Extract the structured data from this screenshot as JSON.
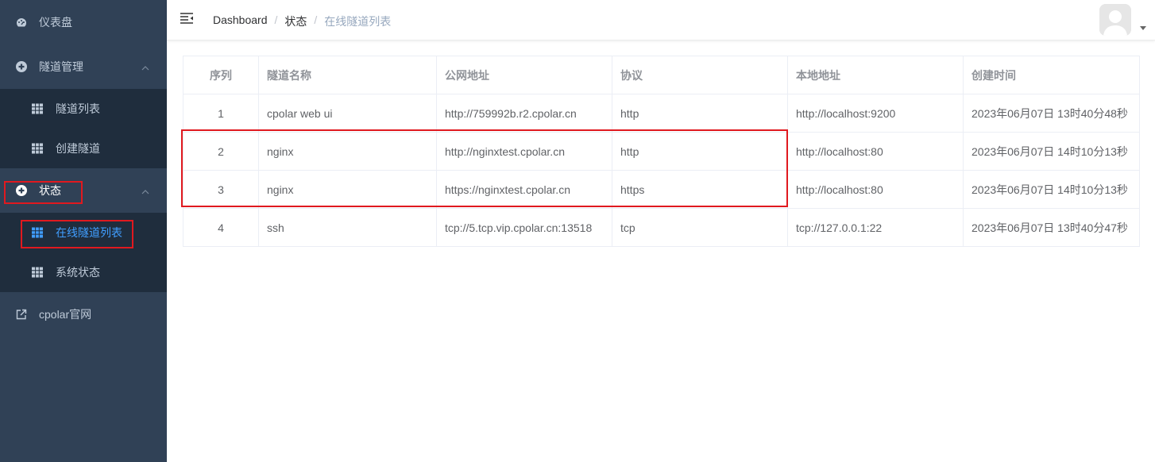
{
  "sidebar": {
    "dashboard": "仪表盘",
    "tunnel_mgmt": "隧道管理",
    "tunnel_list": "隧道列表",
    "create_tunnel": "创建隧道",
    "status": "状态",
    "online_tunnels": "在线隧道列表",
    "system_status": "系统状态",
    "cpolar_site": "cpolar官网"
  },
  "breadcrumb": {
    "items": [
      "Dashboard",
      "状态",
      "在线隧道列表"
    ],
    "separator": "/"
  },
  "table": {
    "headers": [
      "序列",
      "隧道名称",
      "公网地址",
      "协议",
      "本地地址",
      "创建时间"
    ],
    "rows": [
      [
        "1",
        "cpolar web ui",
        "http://759992b.r2.cpolar.cn",
        "http",
        "http://localhost:9200",
        "2023年06月07日 13时40分48秒"
      ],
      [
        "2",
        "nginx",
        "http://nginxtest.cpolar.cn",
        "http",
        "http://localhost:80",
        "2023年06月07日 14时10分13秒"
      ],
      [
        "3",
        "nginx",
        "https://nginxtest.cpolar.cn",
        "https",
        "http://localhost:80",
        "2023年06月07日 14时10分13秒"
      ],
      [
        "4",
        "ssh",
        "tcp://5.tcp.vip.cpolar.cn:13518",
        "tcp",
        "tcp://127.0.0.1:22",
        "2023年06月07日 13时40分47秒"
      ]
    ]
  },
  "colors": {
    "sidebar_bg": "#304156",
    "submenu_bg": "#1f2d3d",
    "active": "#409eff",
    "highlight": "#e0191f"
  }
}
